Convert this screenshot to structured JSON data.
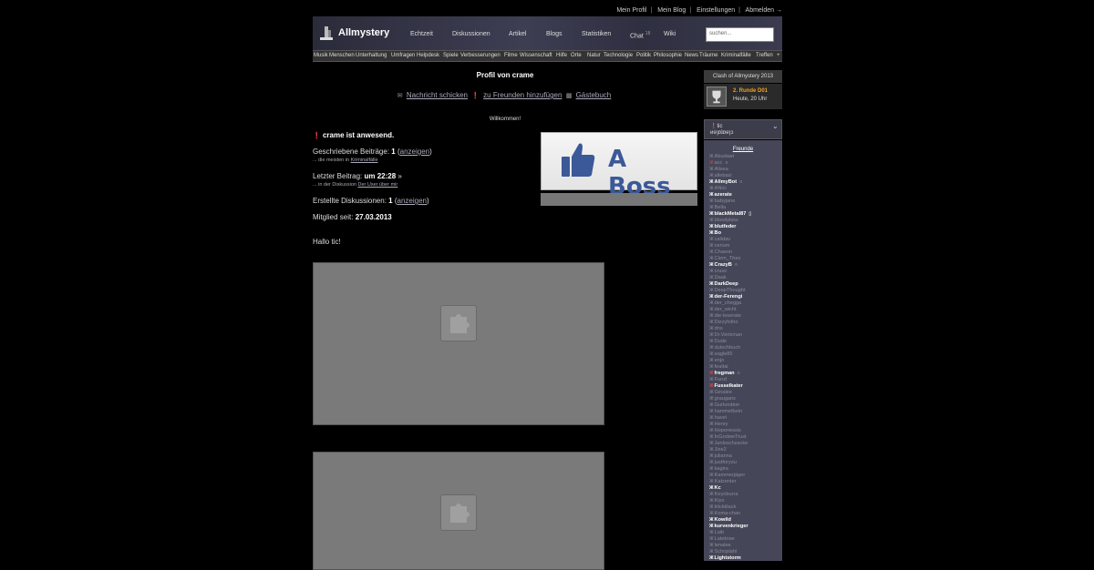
{
  "toplinks": [
    "Mein Profil",
    "Mein Blog",
    "Einstellungen",
    "Abmelden →"
  ],
  "brand": {
    "name": "Allmystery"
  },
  "nav": [
    "Echtzeit",
    "Diskussionen",
    "Artikel",
    "Blogs",
    "Statistiken",
    "Chat",
    "Wiki"
  ],
  "chat_count": "18",
  "search": {
    "placeholder": "suchen..."
  },
  "categories": [
    "Musik",
    "Menschen",
    "Unterhaltung",
    "Umfragen",
    "Helpdesk",
    "Spiele",
    "Verbesserungen",
    "Filme",
    "Wissenschaft",
    "Hilfe",
    "Orte",
    "Natur",
    "Technologie",
    "Politik",
    "Philosophie",
    "News",
    "Träume",
    "Kriminalfälle",
    "Treffen",
    "+"
  ],
  "profile": {
    "title": "Profil von crame",
    "actions": [
      "Nachricht schicken",
      "zu Freunden hinzufügen",
      "Gästebuch"
    ],
    "welcome": "Willkommen!",
    "present": "crame ist anwesend.",
    "posts_label": "Geschriebene Beiträge:",
    "posts_count": "1",
    "show": "anzeigen",
    "posts_most_prefix": "... die meisten in",
    "posts_most_link": "Kriminalfälle",
    "last_label": "Letzter Beitrag:",
    "last_time": "um 22:28",
    "last_arrow": "»",
    "last_sub_prefix": "... in der Diskussion",
    "last_sub_link": "Der User über mir",
    "created_label": "Erstellte Diskussionen:",
    "created_count": "1",
    "member_label": "Mitglied seit:",
    "member_date": "27.03.2013",
    "greeting": "Hallo tic!",
    "boss_text": "A Boss"
  },
  "sidebar": {
    "clash_title": "Clash of Allmystery 2013",
    "clash_round": "2. Runde D01",
    "clash_time": "Heute, 20 Uhr",
    "user": "tic",
    "user_sub": "ᴎɘɿɒʇɒɘɿɔ",
    "friends_title": "Freunde",
    "friends": [
      {
        "name": "Abudawi",
        "online": false,
        "badge": ""
      },
      {
        "name": "acc",
        "online": false,
        "badge": "○",
        "red": true
      },
      {
        "name": "Alisea",
        "online": false,
        "badge": ""
      },
      {
        "name": "allebasi",
        "online": false,
        "badge": ""
      },
      {
        "name": "AllmyBot",
        "online": true,
        "badge": "○"
      },
      {
        "name": "ANici",
        "online": false,
        "badge": ""
      },
      {
        "name": "azerate",
        "online": true,
        "badge": ""
      },
      {
        "name": "babyjane",
        "online": false,
        "badge": ""
      },
      {
        "name": "Bella",
        "online": false,
        "badge": ""
      },
      {
        "name": "blackMetal87",
        "online": true,
        "badge": "▯"
      },
      {
        "name": "bloodykiss",
        "online": false,
        "badge": ""
      },
      {
        "name": "blutfeder",
        "online": true,
        "badge": ""
      },
      {
        "name": "Bo",
        "online": true,
        "badge": ""
      },
      {
        "name": "calidav",
        "online": false,
        "badge": ""
      },
      {
        "name": "cerium",
        "online": false,
        "badge": ""
      },
      {
        "name": "Chaeon",
        "online": false,
        "badge": ""
      },
      {
        "name": "Clem_Theo",
        "online": false,
        "badge": ""
      },
      {
        "name": "CrazyB",
        "online": true,
        "badge": "○"
      },
      {
        "name": "cruso",
        "online": false,
        "badge": ""
      },
      {
        "name": "Daak",
        "online": false,
        "badge": ""
      },
      {
        "name": "DarkDeep",
        "online": true,
        "badge": ""
      },
      {
        "name": "DeepThought",
        "online": false,
        "badge": ""
      },
      {
        "name": "der-Ferengi",
        "online": true,
        "badge": ""
      },
      {
        "name": "der_chegga",
        "online": false,
        "badge": ""
      },
      {
        "name": "der_wicht",
        "online": false,
        "badge": ""
      },
      {
        "name": "die-leserate",
        "online": false,
        "badge": ""
      },
      {
        "name": "Dizzyhitho",
        "online": false,
        "badge": ""
      },
      {
        "name": "dns",
        "online": false,
        "badge": ""
      },
      {
        "name": "Dr.Venkman",
        "online": false,
        "badge": ""
      },
      {
        "name": "Dude",
        "online": false,
        "badge": ""
      },
      {
        "name": "dutschbuch",
        "online": false,
        "badge": ""
      },
      {
        "name": "eagle85",
        "online": false,
        "badge": ""
      },
      {
        "name": "enjo",
        "online": false,
        "badge": ""
      },
      {
        "name": "fealtai",
        "online": false,
        "badge": ""
      },
      {
        "name": "fregman",
        "online": true,
        "badge": "○",
        "red": true
      },
      {
        "name": "Funzl",
        "online": false,
        "badge": ""
      },
      {
        "name": "Fusselkater",
        "online": true,
        "badge": "",
        "red": true
      },
      {
        "name": "Ginalee",
        "online": false,
        "badge": ""
      },
      {
        "name": "grauganx",
        "online": false,
        "badge": ""
      },
      {
        "name": "Gurkenbier",
        "online": false,
        "badge": ""
      },
      {
        "name": "hammelbein",
        "online": false,
        "badge": ""
      },
      {
        "name": "havel",
        "online": false,
        "badge": ""
      },
      {
        "name": "Henry",
        "online": false,
        "badge": ""
      },
      {
        "name": "Hopenessis",
        "online": false,
        "badge": ""
      },
      {
        "name": "InGodweTrust",
        "online": false,
        "badge": ""
      },
      {
        "name": "Janloschzacke",
        "online": false,
        "badge": ""
      },
      {
        "name": "Jixe2",
        "online": false,
        "badge": ""
      },
      {
        "name": "julianna",
        "online": false,
        "badge": ""
      },
      {
        "name": "justforyou",
        "online": false,
        "badge": ""
      },
      {
        "name": "kagira",
        "online": false,
        "badge": ""
      },
      {
        "name": "Kammerjäger",
        "online": false,
        "badge": ""
      },
      {
        "name": "Katzenter",
        "online": false,
        "badge": ""
      },
      {
        "name": "Kc",
        "online": true,
        "badge": ""
      },
      {
        "name": "Keyoburra",
        "online": false,
        "badge": ""
      },
      {
        "name": "Kiyo",
        "online": false,
        "badge": ""
      },
      {
        "name": "klickklack",
        "online": false,
        "badge": ""
      },
      {
        "name": "Koma-chan",
        "online": false,
        "badge": ""
      },
      {
        "name": "Kowild",
        "online": true,
        "badge": ""
      },
      {
        "name": "kurvenkrieger",
        "online": true,
        "badge": ""
      },
      {
        "name": "Laib",
        "online": false,
        "badge": ""
      },
      {
        "name": "Latebrae",
        "online": false,
        "badge": ""
      },
      {
        "name": "lenalee",
        "online": false,
        "badge": ""
      },
      {
        "name": "Schoplahl",
        "online": false,
        "badge": ""
      },
      {
        "name": "Lightstorm",
        "online": true,
        "badge": ""
      }
    ]
  },
  "colors": {
    "accent": "#f0a020",
    "link": "#aab",
    "friends_bg": "#454759",
    "plugin": "#7a7a7a",
    "boss": "#3b5998"
  }
}
